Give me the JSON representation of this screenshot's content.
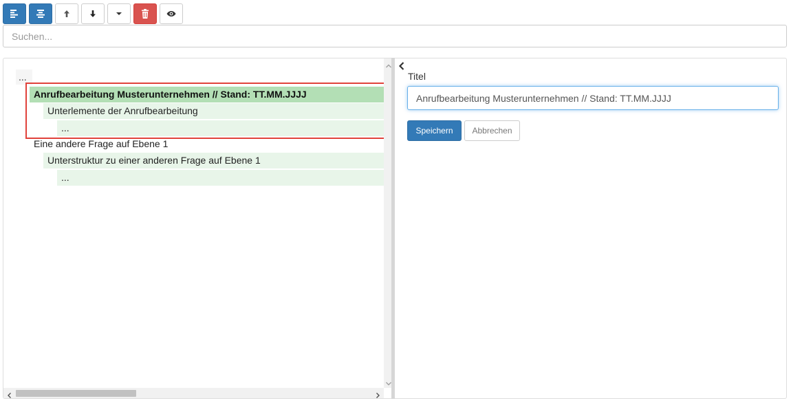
{
  "toolbar": {
    "buttons": [
      {
        "icon": "align-left-icon",
        "style": "primary"
      },
      {
        "icon": "align-center-icon",
        "style": "primary"
      },
      {
        "icon": "arrow-up-icon",
        "style": "default"
      },
      {
        "icon": "arrow-down-icon",
        "style": "default"
      },
      {
        "icon": "caret-down-icon",
        "style": "default"
      },
      {
        "icon": "trash-icon",
        "style": "danger"
      },
      {
        "icon": "eye-icon",
        "style": "default"
      }
    ]
  },
  "search": {
    "placeholder": "Suchen...",
    "value": ""
  },
  "tree": {
    "root_ellipsis": "...",
    "nodes": [
      {
        "label": "Anrufbearbeitung Musterunternehmen // Stand: TT.MM.JJJJ",
        "level": 1,
        "state": "selected"
      },
      {
        "label": "Unterlemente der Anrufbearbeitung",
        "level": 2,
        "state": "light"
      },
      {
        "label": "...",
        "level": 3,
        "state": "light"
      },
      {
        "label": "Eine andere Frage auf Ebene 1",
        "level": 1,
        "state": "none"
      },
      {
        "label": "Unterstruktur zu einer anderen Frage auf Ebene 1",
        "level": 2,
        "state": "light"
      },
      {
        "label": "...",
        "level": 3,
        "state": "light"
      }
    ]
  },
  "editor": {
    "field_label": "Titel",
    "title_value": "Anrufbearbeitung Musterunternehmen // Stand: TT.MM.JJJJ",
    "save_label": "Speichern",
    "cancel_label": "Abbrechen"
  },
  "colors": {
    "primary": "#337ab7",
    "danger": "#d9534f",
    "selected_node": "#b3dfb5",
    "light_node": "#e8f5e9",
    "highlight_border": "#e0413a"
  }
}
